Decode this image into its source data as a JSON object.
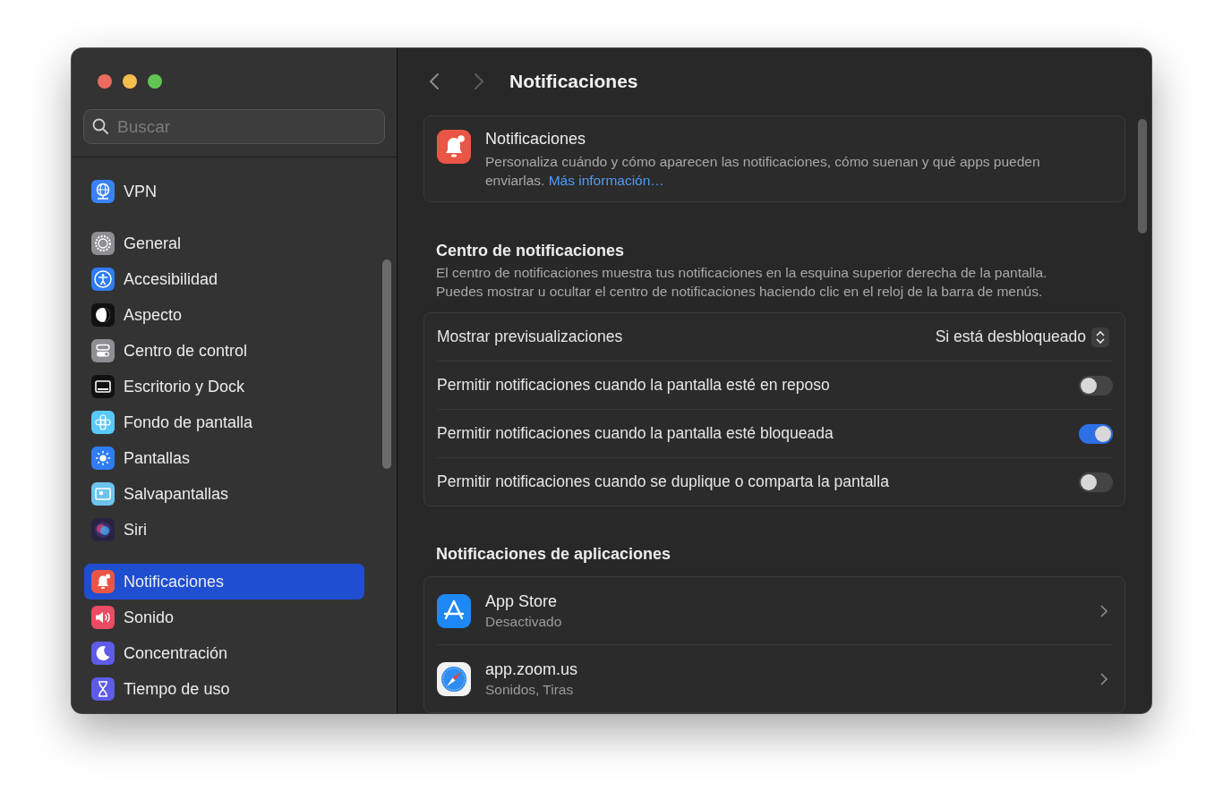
{
  "window": {
    "controls": [
      {
        "kind": "close"
      },
      {
        "kind": "minimize"
      },
      {
        "kind": "zoom"
      }
    ]
  },
  "sidebar": {
    "search": {
      "placeholder": "Buscar"
    },
    "groups": [
      {
        "items": [
          {
            "label": "VPN",
            "kind": "vpn",
            "selected": false
          }
        ]
      },
      {
        "items": [
          {
            "label": "General",
            "kind": "gear",
            "selected": false
          },
          {
            "label": "Accesibilidad",
            "kind": "accessibility",
            "selected": false
          },
          {
            "label": "Aspecto",
            "kind": "appearance",
            "selected": false
          },
          {
            "label": "Centro de control",
            "kind": "switches",
            "selected": false
          },
          {
            "label": "Escritorio y Dock",
            "kind": "desktop",
            "selected": false
          },
          {
            "label": "Fondo de pantalla",
            "kind": "flower",
            "selected": false
          },
          {
            "label": "Pantallas",
            "kind": "sun",
            "selected": false
          },
          {
            "label": "Salvapantallas",
            "kind": "screensaver",
            "selected": false
          },
          {
            "label": "Siri",
            "kind": "siri",
            "selected": false
          }
        ]
      },
      {
        "items": [
          {
            "label": "Notificaciones",
            "kind": "bell",
            "selected": true
          },
          {
            "label": "Sonido",
            "kind": "speaker",
            "selected": false
          },
          {
            "label": "Concentración",
            "kind": "moon",
            "selected": false
          },
          {
            "label": "Tiempo de uso",
            "kind": "hourglass",
            "selected": false
          }
        ]
      }
    ]
  },
  "header": {
    "title": "Notificaciones"
  },
  "intro": {
    "title": "Notificaciones",
    "text": "Personaliza cuándo y cómo aparecen las notificaciones, cómo suenan y qué apps pueden enviarlas.",
    "link": "Más información…"
  },
  "notification_center": {
    "heading": "Centro de notificaciones",
    "text": "El centro de notificaciones muestra tus notificaciones en la esquina superior derecha de la pantalla. Puedes mostrar u ocultar el centro de notificaciones haciendo clic en el reloj de la barra de menús.",
    "settings": [
      {
        "kind": "popup",
        "label": "Mostrar previsualizaciones",
        "value": "Si está desbloqueado"
      },
      {
        "kind": "toggle",
        "label": "Permitir notificaciones cuando la pantalla esté en reposo",
        "on": false
      },
      {
        "kind": "toggle",
        "label": "Permitir notificaciones cuando la pantalla esté bloqueada",
        "on": true
      },
      {
        "kind": "toggle",
        "label": "Permitir notificaciones cuando se duplique o comparta la pantalla",
        "on": false
      }
    ]
  },
  "app_notifications": {
    "heading": "Notificaciones de aplicaciones",
    "apps": [
      {
        "name": "App Store",
        "status": "Desactivado",
        "kind": "appstore"
      },
      {
        "name": "app.zoom.us",
        "status": "Sonidos, Tiras",
        "kind": "compass"
      }
    ]
  }
}
